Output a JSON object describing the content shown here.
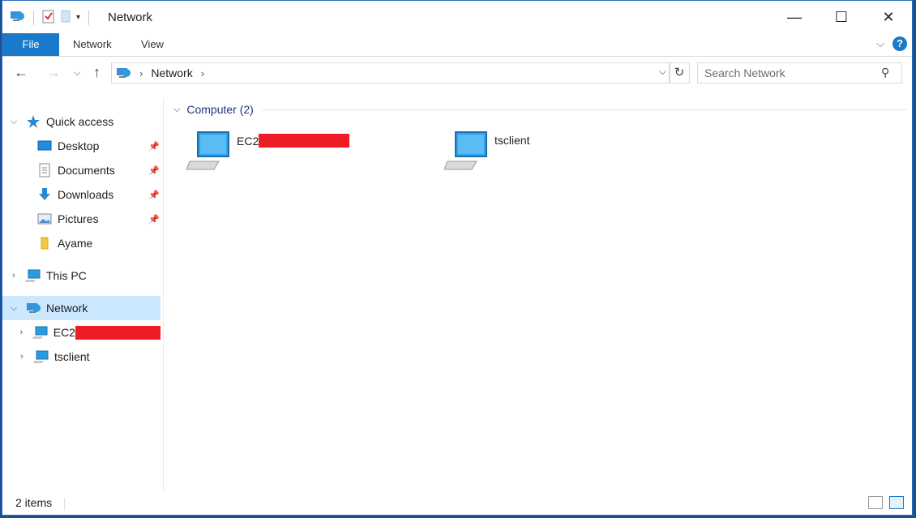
{
  "window": {
    "title": "Network",
    "controls": {
      "minimize": "—",
      "maximize": "☐",
      "close": "✕"
    }
  },
  "ribbon": {
    "tabs": [
      {
        "label": "File"
      },
      {
        "label": "Network"
      },
      {
        "label": "View"
      }
    ],
    "help_label": "?"
  },
  "address": {
    "root_label": "Network",
    "search_placeholder": "Search Network"
  },
  "navpane": {
    "quick_access": "Quick access",
    "pinned": [
      {
        "label": "Desktop"
      },
      {
        "label": "Documents"
      },
      {
        "label": "Downloads"
      },
      {
        "label": "Pictures"
      }
    ],
    "ayame": "Ayame",
    "this_pc": "This PC",
    "network": "Network",
    "ec2_prefix": "EC2",
    "tsclient": "tsclient"
  },
  "content": {
    "group_title": "Computer (2)",
    "tiles": [
      {
        "label": "EC2"
      },
      {
        "label": "tsclient"
      }
    ]
  },
  "status": {
    "item_count": "2 items"
  },
  "colors": {
    "accent": "#1979ca",
    "selected_bg": "#cce8ff",
    "redaction": "#ee1c25",
    "group_text": "#1e3287"
  },
  "icons": {
    "network": "network-icon",
    "computer": "computer-icon",
    "folder": "folder-icon"
  }
}
